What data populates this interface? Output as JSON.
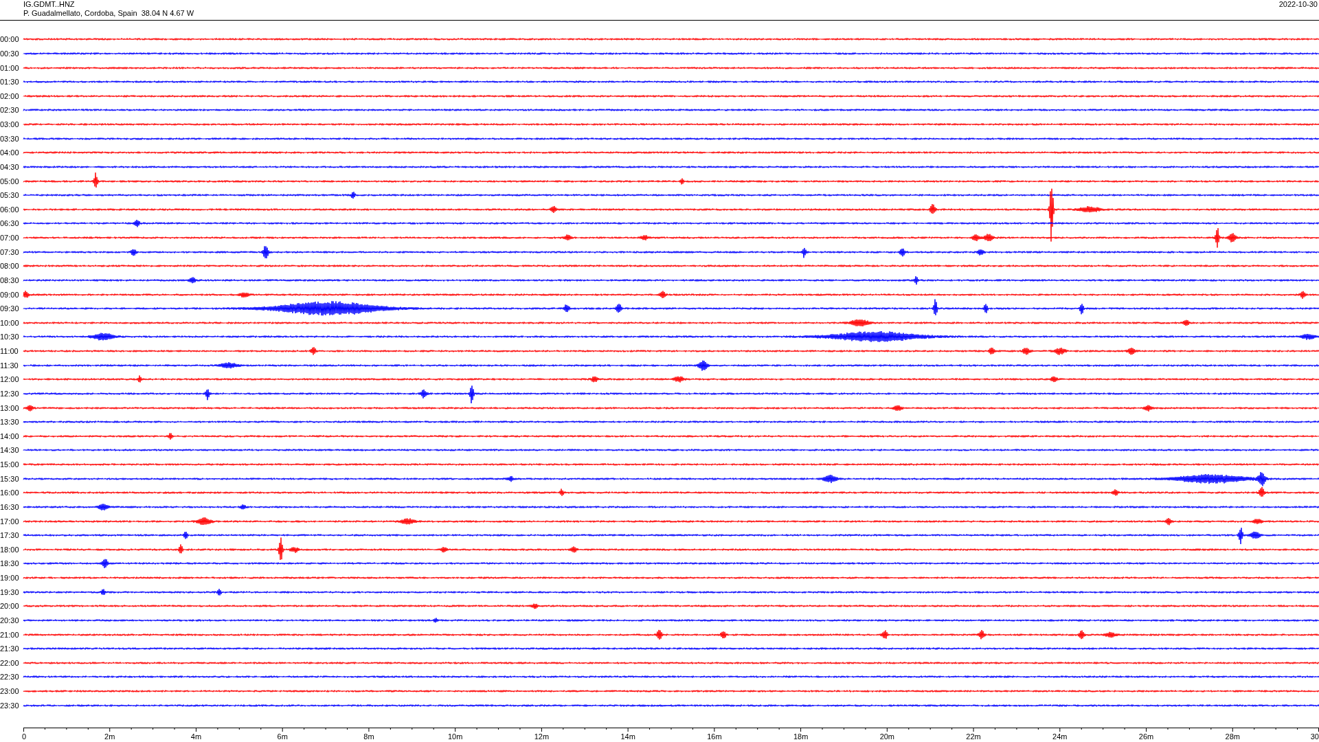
{
  "header": {
    "station": "IG.GDMT..HNZ",
    "location": "P. Guadalmellato, Cordoba, Spain  38.04 N 4.67 W",
    "date": "2022-10-30"
  },
  "traces": [
    {
      "time": "00:00",
      "color": "#ff0000"
    },
    {
      "time": "00:30",
      "color": "#0000ff"
    },
    {
      "time": "01:00",
      "color": "#ff0000"
    },
    {
      "time": "01:30",
      "color": "#0000ff"
    },
    {
      "time": "02:00",
      "color": "#ff0000"
    },
    {
      "time": "02:30",
      "color": "#0000ff"
    },
    {
      "time": "03:00",
      "color": "#ff0000"
    },
    {
      "time": "03:30",
      "color": "#0000ff"
    },
    {
      "time": "04:00",
      "color": "#ff0000"
    },
    {
      "time": "04:30",
      "color": "#0000ff"
    },
    {
      "time": "05:00",
      "color": "#ff0000"
    },
    {
      "time": "05:30",
      "color": "#0000ff"
    },
    {
      "time": "06:00",
      "color": "#ff0000"
    },
    {
      "time": "06:30",
      "color": "#0000ff"
    },
    {
      "time": "07:00",
      "color": "#ff0000"
    },
    {
      "time": "07:30",
      "color": "#0000ff"
    },
    {
      "time": "08:00",
      "color": "#ff0000"
    },
    {
      "time": "08:30",
      "color": "#0000ff"
    },
    {
      "time": "09:00",
      "color": "#ff0000"
    },
    {
      "time": "09:30",
      "color": "#0000ff"
    },
    {
      "time": "10:00",
      "color": "#ff0000"
    },
    {
      "time": "10:30",
      "color": "#0000ff"
    },
    {
      "time": "11:00",
      "color": "#ff0000"
    },
    {
      "time": "11:30",
      "color": "#0000ff"
    },
    {
      "time": "12:00",
      "color": "#ff0000"
    },
    {
      "time": "12:30",
      "color": "#0000ff"
    },
    {
      "time": "13:00",
      "color": "#ff0000"
    },
    {
      "time": "13:30",
      "color": "#0000ff"
    },
    {
      "time": "14:00",
      "color": "#ff0000"
    },
    {
      "time": "14:30",
      "color": "#0000ff"
    },
    {
      "time": "15:00",
      "color": "#ff0000"
    },
    {
      "time": "15:30",
      "color": "#0000ff"
    },
    {
      "time": "16:00",
      "color": "#ff0000"
    },
    {
      "time": "16:30",
      "color": "#0000ff"
    },
    {
      "time": "17:00",
      "color": "#ff0000"
    },
    {
      "time": "17:30",
      "color": "#0000ff"
    },
    {
      "time": "18:00",
      "color": "#ff0000"
    },
    {
      "time": "18:30",
      "color": "#0000ff"
    },
    {
      "time": "19:00",
      "color": "#ff0000"
    },
    {
      "time": "19:30",
      "color": "#0000ff"
    },
    {
      "time": "20:00",
      "color": "#ff0000"
    },
    {
      "time": "20:30",
      "color": "#0000ff"
    },
    {
      "time": "21:00",
      "color": "#ff0000"
    },
    {
      "time": "21:30",
      "color": "#0000ff"
    },
    {
      "time": "22:00",
      "color": "#ff0000"
    },
    {
      "time": "22:30",
      "color": "#0000ff"
    },
    {
      "time": "23:00",
      "color": "#ff0000"
    },
    {
      "time": "23:30",
      "color": "#0000ff"
    }
  ],
  "axis": {
    "labels": [
      "0",
      "2m",
      "4m",
      "6m",
      "8m",
      "10m",
      "12m",
      "14m",
      "16m",
      "18m",
      "20m",
      "22m",
      "24m",
      "26m",
      "28m",
      "30"
    ]
  }
}
